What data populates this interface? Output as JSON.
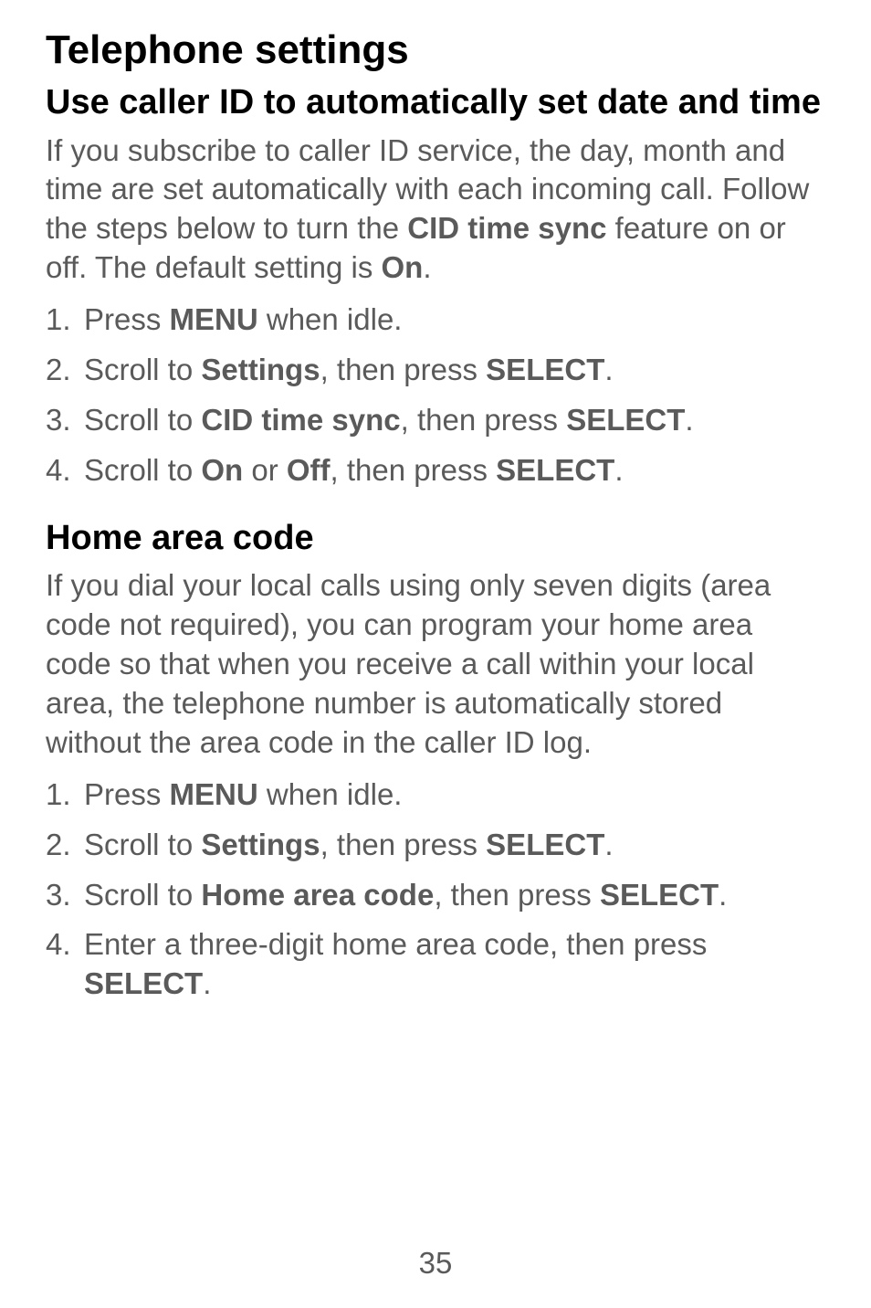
{
  "page_title": "Telephone settings",
  "section1": {
    "heading": "Use caller ID to automatically set date and time",
    "intro_parts": [
      "If you subscribe to caller ID service, the day, month and time are set automatically with each incoming call. Follow the steps below to turn the ",
      "CID time sync",
      " feature on or off. The default setting is ",
      "On",
      "."
    ],
    "steps": [
      {
        "parts": [
          "Press ",
          "MENU",
          " when idle."
        ]
      },
      {
        "parts": [
          "Scroll to ",
          "Settings",
          ", then press ",
          "SELECT",
          "."
        ]
      },
      {
        "parts": [
          "Scroll to ",
          "CID time sync",
          ", then press ",
          "SELECT",
          "."
        ]
      },
      {
        "parts": [
          "Scroll to ",
          "On",
          " or ",
          "Off",
          ", then press ",
          "SELECT",
          "."
        ]
      }
    ]
  },
  "section2": {
    "heading": "Home area code",
    "intro": "If you dial your local calls using only seven digits (area code not required), you can program your home area code so that when you receive a call within your local area, the telephone number is automatically stored without the area code in the caller ID log.",
    "steps": [
      {
        "parts": [
          "Press ",
          "MENU",
          " when idle."
        ]
      },
      {
        "parts": [
          "Scroll to ",
          "Settings",
          ", then press ",
          "SELECT",
          "."
        ]
      },
      {
        "parts": [
          "Scroll to ",
          "Home area code",
          ", then press ",
          "SELECT",
          "."
        ]
      },
      {
        "parts": [
          "Enter a three-digit home area code, then press ",
          "SELECT",
          "."
        ]
      }
    ]
  },
  "page_number": "35"
}
